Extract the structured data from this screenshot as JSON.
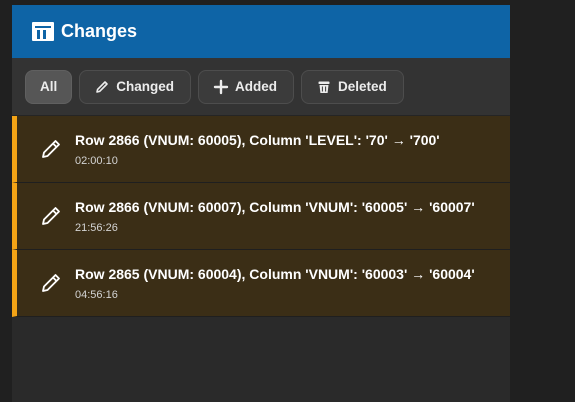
{
  "header": {
    "title": "Changes",
    "icon": "table-chart-icon"
  },
  "toolbar": {
    "buttons": [
      {
        "label": "All",
        "icon": ""
      },
      {
        "label": "Changed",
        "icon": "pencil-icon"
      },
      {
        "label": "Added",
        "icon": "plus-icon"
      },
      {
        "label": "Deleted",
        "icon": "trash-icon"
      }
    ]
  },
  "changes": [
    {
      "message": "Row 2866 (VNUM: 60005), Column 'LEVEL': '70' → '700'",
      "time": "02:00:10",
      "icon": "pencil-icon"
    },
    {
      "message": "Row 2866 (VNUM: 60007), Column 'VNUM': '60005' → '60007'",
      "time": "21:56:26",
      "icon": "pencil-icon"
    },
    {
      "message": "Row 2865 (VNUM: 60004), Column 'VNUM': '60003' → '60004'",
      "time": "04:56:16",
      "icon": "pencil-icon"
    }
  ],
  "colors": {
    "accent": "#f4a416",
    "header": "#0e64a6",
    "row_bg": "#3b2e16"
  }
}
